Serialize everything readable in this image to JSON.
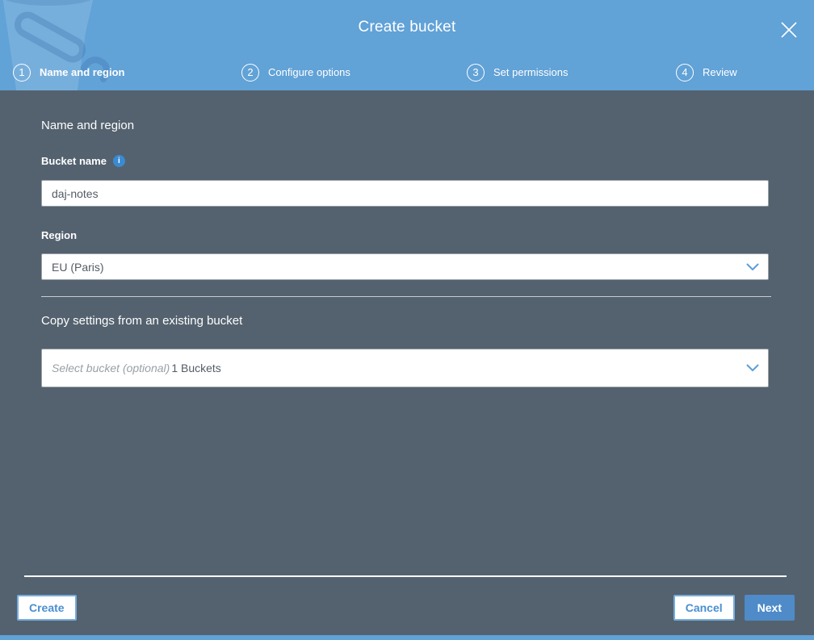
{
  "modal": {
    "title": "Create bucket"
  },
  "steps": [
    {
      "number": "1",
      "label": "Name and region",
      "active": true
    },
    {
      "number": "2",
      "label": "Configure options",
      "active": false
    },
    {
      "number": "3",
      "label": "Set permissions",
      "active": false
    },
    {
      "number": "4",
      "label": "Review",
      "active": false
    }
  ],
  "form": {
    "section_title": "Name and region",
    "bucket_name": {
      "label": "Bucket name",
      "value": "daj-notes",
      "info_glyph": "i"
    },
    "region": {
      "label": "Region",
      "value": "EU (Paris)"
    },
    "copy_settings": {
      "title": "Copy settings from an existing bucket",
      "placeholder": "Select bucket (optional)",
      "count_text": "1 Buckets"
    }
  },
  "footer": {
    "create_label": "Create",
    "cancel_label": "Cancel",
    "next_label": "Next"
  },
  "colors": {
    "header_blue": "#61A2D7",
    "body_slate": "#54626F",
    "accent_blue": "#4a8fd1",
    "next_button_blue": "#4E8BC8",
    "info_icon_blue": "#3A8AD2"
  }
}
